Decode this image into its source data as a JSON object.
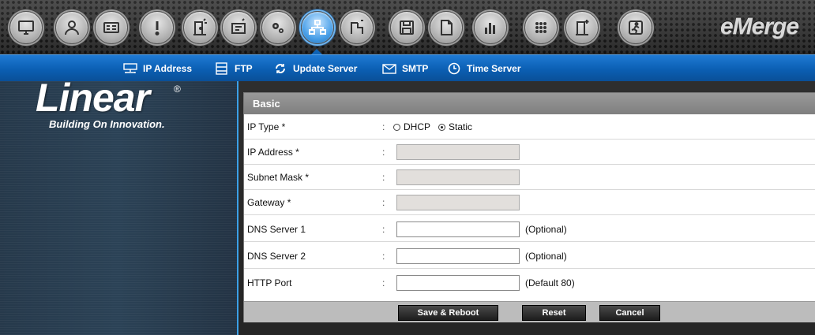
{
  "toolbar": {
    "icons": [
      {
        "name": "monitor-icon"
      },
      {
        "name": "user-icon"
      },
      {
        "name": "id-card-icon"
      },
      {
        "name": "alert-icon"
      },
      {
        "name": "door-config-icon"
      },
      {
        "name": "portal-icon"
      },
      {
        "name": "settings-gears-icon"
      },
      {
        "name": "network-icon",
        "active": true
      },
      {
        "name": "door-network-icon"
      },
      {
        "name": "save-icon"
      },
      {
        "name": "document-icon"
      },
      {
        "name": "bar-chart-icon"
      },
      {
        "name": "keypad-icon"
      },
      {
        "name": "door-add-icon"
      },
      {
        "name": "exit-icon"
      }
    ],
    "brand": "eMerge"
  },
  "subnav": {
    "items": [
      {
        "label": "IP Address",
        "icon": "network-card-icon"
      },
      {
        "label": "FTP",
        "icon": "ftp-icon"
      },
      {
        "label": "Update Server",
        "icon": "refresh-icon"
      },
      {
        "label": "SMTP",
        "icon": "envelope-icon"
      },
      {
        "label": "Time Server",
        "icon": "clock-icon"
      }
    ]
  },
  "sidebar": {
    "logo": "Linear",
    "registered": "®",
    "tagline": "Building On Innovation."
  },
  "form": {
    "section_title": "Basic",
    "ip_type": {
      "label": "IP Type *",
      "colon": ":",
      "options": [
        {
          "label": "DHCP",
          "checked": false
        },
        {
          "label": "Static",
          "checked": true
        }
      ]
    },
    "ip_address": {
      "label": "IP Address *",
      "colon": ":",
      "value": ""
    },
    "subnet_mask": {
      "label": "Subnet Mask *",
      "colon": ":",
      "value": ""
    },
    "gateway": {
      "label": "Gateway *",
      "colon": ":",
      "value": ""
    },
    "dns1": {
      "label": "DNS Server 1",
      "colon": ":",
      "value": "",
      "hint": "(Optional)"
    },
    "dns2": {
      "label": "DNS Server 2",
      "colon": ":",
      "value": "",
      "hint": "(Optional)"
    },
    "http_port": {
      "label": "HTTP Port",
      "colon": ":",
      "value": "",
      "hint": "(Default 80)"
    }
  },
  "buttons": {
    "save_reboot": "Save & Reboot",
    "reset": "Reset",
    "cancel": "Cancel"
  },
  "colors": {
    "accent": "#0b5fb3",
    "active_icon": "#4aa0e8",
    "header_gray": "#8c8c8c"
  }
}
